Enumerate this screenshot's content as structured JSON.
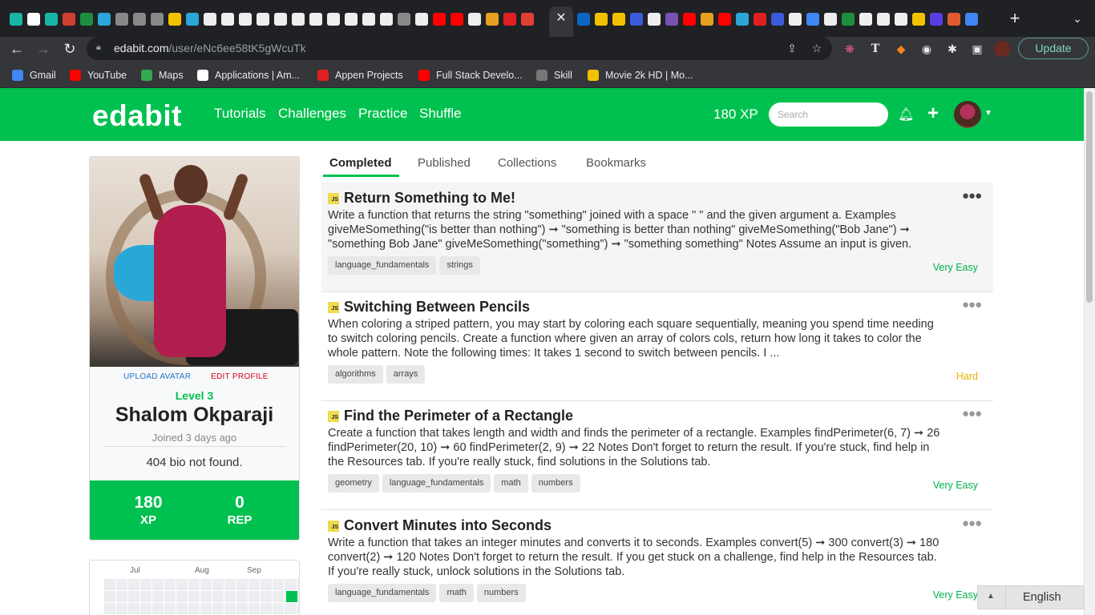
{
  "browser": {
    "url_host": "edabit.com",
    "url_path": "/user/eNc6ee58tK5gWcuTk",
    "update_label": "Update",
    "bookmarks": [
      {
        "label": "Gmail",
        "icon": "google-icon",
        "color": "#4285f4"
      },
      {
        "label": "YouTube",
        "icon": "youtube-icon",
        "color": "#ff0000"
      },
      {
        "label": "Maps",
        "icon": "maps-pin-icon",
        "color": "#34a853"
      },
      {
        "label": "Applications | Am...",
        "icon": "amazon-icon",
        "color": "#ffffff"
      },
      {
        "label": "Appen Projects",
        "icon": "appen-icon",
        "color": "#e02020"
      },
      {
        "label": "Full Stack Develo...",
        "icon": "youtube-icon",
        "color": "#ff0000"
      },
      {
        "label": "Skill",
        "icon": "globe-icon",
        "color": "#777777"
      },
      {
        "label": "Movie 2k HD | Mo...",
        "icon": "2k-icon",
        "color": "#f2c200"
      }
    ]
  },
  "site": {
    "logo": "edabit",
    "nav": [
      "Tutorials",
      "Challenges",
      "Practice",
      "Shuffle"
    ],
    "xp": "180 XP",
    "search_placeholder": "Search",
    "brand_color": "#00c14f"
  },
  "profile": {
    "upload_avatar": "UPLOAD AVATAR",
    "edit_profile": "EDIT PROFILE",
    "level": "Level 3",
    "name": "Shalom Okparaji",
    "joined": "Joined 3 days ago",
    "bio": "404 bio not found.",
    "xp_value": "180",
    "xp_label": "XP",
    "rep_value": "0",
    "rep_label": "REP",
    "months": [
      "Jul",
      "Aug",
      "Sep"
    ]
  },
  "tabs": [
    "Completed",
    "Published",
    "Collections",
    "Bookmarks"
  ],
  "challenges": [
    {
      "badge": "JS",
      "title": "Return Something to Me!",
      "description": "Write a function that returns the string \"something\" joined with a space \" \" and the given argument a. Examples giveMeSomething(\"is better than nothing\") ➞ \"something is better than nothing\" giveMeSomething(\"Bob Jane\") ➞ \"something Bob Jane\" giveMeSomething(\"something\") ➞ \"something something\" Notes Assume an input is given.",
      "tags": [
        "language_fundamentals",
        "strings"
      ],
      "difficulty": "Very Easy",
      "difficulty_color": "#00b34a"
    },
    {
      "badge": "JS",
      "title": "Switching Between Pencils",
      "description": "When coloring a striped pattern, you may start by coloring each square sequentially, meaning you spend time needing to switch coloring pencils. Create a function where given an array of colors cols, return how long it takes to color the whole pattern. Note the following times: It takes 1 second to switch between pencils. I ...",
      "tags": [
        "algorithms",
        "arrays"
      ],
      "difficulty": "Hard",
      "difficulty_color": "#e5b000"
    },
    {
      "badge": "JS",
      "title": "Find the Perimeter of a Rectangle",
      "description": "Create a function that takes length and width and finds the perimeter of a rectangle. Examples findPerimeter(6, 7) ➞ 26 findPerimeter(20, 10) ➞ 60 findPerimeter(2, 9) ➞ 22 Notes Don't forget to return the result. If you're stuck, find help in the Resources tab. If you're really stuck, find solutions in the Solutions tab.",
      "tags": [
        "geometry",
        "language_fundamentals",
        "math",
        "numbers"
      ],
      "difficulty": "Very Easy",
      "difficulty_color": "#00b34a"
    },
    {
      "badge": "JS",
      "title": "Convert Minutes into Seconds",
      "description": "Write a function that takes an integer minutes and converts it to seconds. Examples convert(5) ➞ 300 convert(3) ➞ 180 convert(2) ➞ 120 Notes Don't forget to return the result. If you get stuck on a challenge, find help in the Resources tab. If you're really stuck, unlock solutions in the Solutions tab.",
      "tags": [
        "language_fundamentals",
        "math",
        "numbers"
      ],
      "difficulty": "Very Easy",
      "difficulty_color": "#00b34a"
    }
  ],
  "language": "English"
}
